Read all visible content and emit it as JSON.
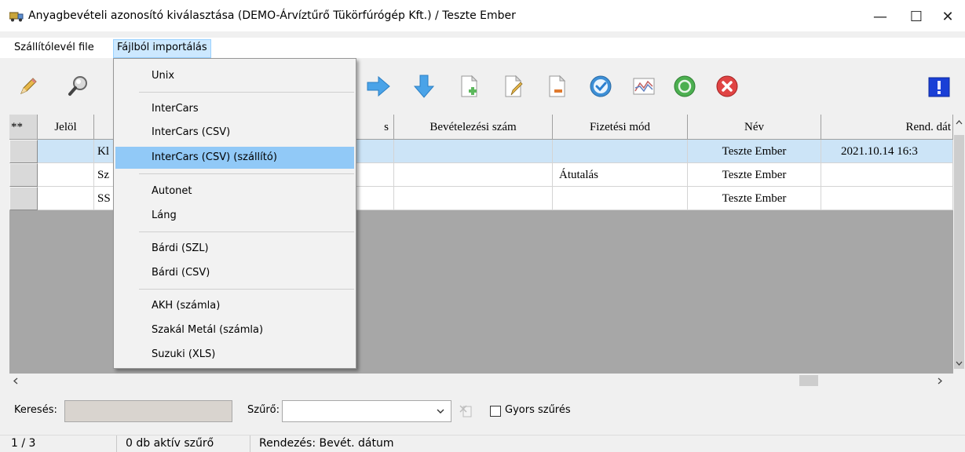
{
  "window": {
    "title": "Anyagbevételi azonosító kiválasztása (DEMO-Árvíztűrő Tükörfúrógép Kft.) / Teszte Ember",
    "minimize": "—",
    "maximize": "☐",
    "close": "✕"
  },
  "menubar": {
    "items": [
      "Szállítólevél file",
      "Fájlból importálás"
    ]
  },
  "dropdown": {
    "groups": [
      [
        "Unix"
      ],
      [
        "InterCars",
        "InterCars (CSV)",
        "InterCars (CSV) (szállító)"
      ],
      [
        "Autonet",
        "Láng"
      ],
      [
        "Bárdi (SZL)",
        "Bárdi (CSV)"
      ],
      [
        "AKH (számla)",
        "Szakál Metál (számla)",
        "Suzuki (XLS)"
      ]
    ],
    "highlighted": "InterCars (CSV) (szállító)"
  },
  "toolbar": {
    "icons": [
      "pencil-icon",
      "magnifier-icon",
      "arrow-right-icon",
      "arrow-down-icon",
      "document-add-icon",
      "document-edit-icon",
      "document-remove-icon",
      "check-circle-icon",
      "chart-icon",
      "refresh-circle-icon",
      "cancel-circle-icon",
      "info-icon"
    ]
  },
  "grid": {
    "corner": "**",
    "columns": [
      "Jelöl",
      "s",
      "Bevételezési szám",
      "Fizetési mód",
      "Név",
      "Rend. dát"
    ],
    "rows": [
      {
        "c2": "Kl",
        "fizetesi": "",
        "nev": "Teszte Ember",
        "rend": "2021.10.14 16:3",
        "selected": true
      },
      {
        "c2": "Sz",
        "fizetesi": "Átutalás",
        "nev": "Teszte Ember",
        "rend": "",
        "selected": false
      },
      {
        "c2": "SS",
        "fizetesi": "",
        "nev": "Teszte Ember",
        "rend": "",
        "selected": false
      }
    ]
  },
  "search": {
    "label": "Keresés:",
    "value": "",
    "filter_label": "Szűrő:",
    "filter_value": "",
    "quick_filter_label": "Gyors szűrés",
    "quick_filter_checked": false
  },
  "status": {
    "position": "1 / 3",
    "active_filters": "0 db aktív szűrő",
    "sorting": "Rendezés: Bevét. dátum"
  },
  "colors": {
    "menu_highlight": "#91c9f7",
    "row_selected": "#cce4f7",
    "grid_background": "#a7a7a7"
  }
}
